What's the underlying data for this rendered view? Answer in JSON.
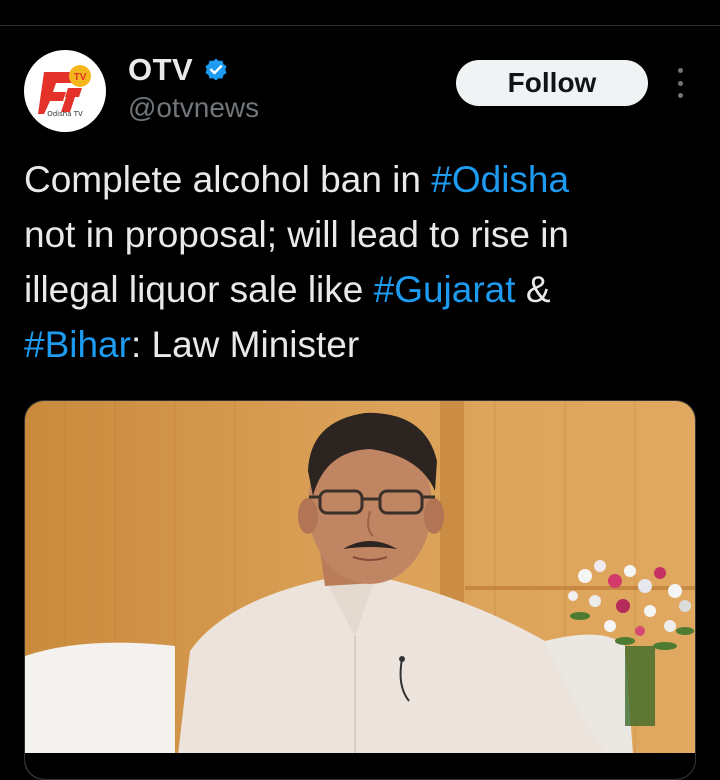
{
  "author": {
    "display_name": "OTV",
    "handle": "@otvnews",
    "avatar_caption": "Odisha TV",
    "verified": true
  },
  "actions": {
    "follow_label": "Follow"
  },
  "tweet": {
    "lines": [
      [
        {
          "text": "Complete alcohol ban in ",
          "type": "text"
        },
        {
          "text": "#Odisha",
          "type": "hashtag"
        }
      ],
      [
        {
          "text": "not in proposal; will lead to rise in",
          "type": "text"
        }
      ],
      [
        {
          "text": "illegal liquor sale like ",
          "type": "text"
        },
        {
          "text": "#Gujarat",
          "type": "hashtag"
        },
        {
          "text": " &",
          "type": "text"
        }
      ],
      [
        {
          "text": "#Bihar",
          "type": "hashtag"
        },
        {
          "text": ": Law Minister",
          "type": "text"
        }
      ]
    ]
  },
  "media": {
    "kind": "photo"
  },
  "colors": {
    "background": "#000000",
    "text": "#e7e9ea",
    "secondary": "#71767b",
    "hashtag": "#1d9bf0",
    "verified": "#1d9bf0",
    "logo_red": "#e4322b",
    "logo_yellow": "#f5b51d"
  },
  "icons": {
    "verified": "verified-badge-icon",
    "more": "more-dots-icon",
    "logo": "otv-logo-icon"
  }
}
